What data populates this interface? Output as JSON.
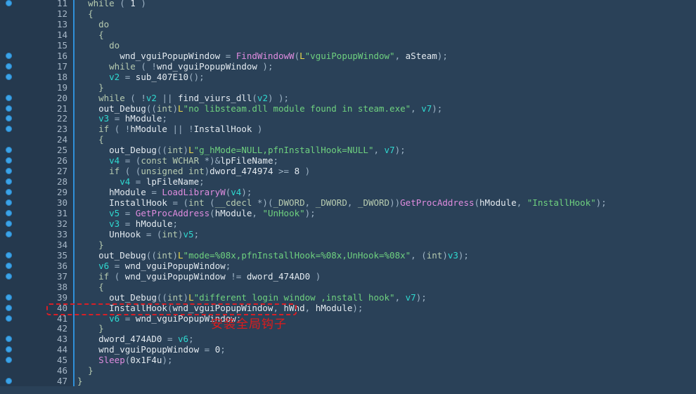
{
  "editor": {
    "kind": "decompiler-pseudocode-view",
    "colors": {
      "background": "#2a4158",
      "gutter": "#25394e",
      "gutter_rule": "#2f8fd8",
      "breakpoint_dot": "#3ba3e8",
      "line_number": "#a8b8c8",
      "keyword": "#b7cbb0",
      "function": "#df8cdf",
      "string": "#6fd17f",
      "wide_string_prefix": "#e8d84a",
      "local_variable": "#2fd9d0",
      "plain": "#e3eaf0",
      "annotation": "#e01b1b"
    },
    "first_line_number": 11,
    "last_line_number": 47
  },
  "annotations": {
    "highlight_box": {
      "target_line": 40,
      "label": "red-dashed-callout-box"
    },
    "note": {
      "text": "安装全局钩子",
      "translation_hint": "install global hook"
    }
  },
  "lines": [
    {
      "n": 11,
      "dot": true,
      "tokens": [
        {
          "c": "t-plain",
          "t": "  "
        },
        {
          "c": "t-kw",
          "t": "while"
        },
        {
          "c": "t-punc",
          "t": " ( "
        },
        {
          "c": "t-num",
          "t": "1"
        },
        {
          "c": "t-punc",
          "t": " )"
        }
      ]
    },
    {
      "n": 12,
      "dot": false,
      "tokens": [
        {
          "c": "t-plain",
          "t": "  "
        },
        {
          "c": "t-brace",
          "t": "{"
        }
      ]
    },
    {
      "n": 13,
      "dot": false,
      "tokens": [
        {
          "c": "t-plain",
          "t": "    "
        },
        {
          "c": "t-kw",
          "t": "do"
        }
      ]
    },
    {
      "n": 14,
      "dot": false,
      "tokens": [
        {
          "c": "t-plain",
          "t": "    "
        },
        {
          "c": "t-brace",
          "t": "{"
        }
      ]
    },
    {
      "n": 15,
      "dot": false,
      "tokens": [
        {
          "c": "t-plain",
          "t": "      "
        },
        {
          "c": "t-kw",
          "t": "do"
        }
      ]
    },
    {
      "n": 16,
      "dot": true,
      "tokens": [
        {
          "c": "t-plain",
          "t": "        wnd_vguiPopupWindow "
        },
        {
          "c": "t-punc",
          "t": "= "
        },
        {
          "c": "t-func",
          "t": "FindWindowW"
        },
        {
          "c": "t-punc",
          "t": "("
        },
        {
          "c": "t-lpfx",
          "t": "L"
        },
        {
          "c": "t-str",
          "t": "\"vguiPopupWindow\""
        },
        {
          "c": "t-punc",
          "t": ", "
        },
        {
          "c": "t-plain",
          "t": "aSteam"
        },
        {
          "c": "t-punc",
          "t": ");"
        }
      ]
    },
    {
      "n": 17,
      "dot": true,
      "tokens": [
        {
          "c": "t-plain",
          "t": "      "
        },
        {
          "c": "t-kw",
          "t": "while"
        },
        {
          "c": "t-punc",
          "t": " ( !"
        },
        {
          "c": "t-plain",
          "t": "wnd_vguiPopupWindow"
        },
        {
          "c": "t-punc",
          "t": " );"
        }
      ]
    },
    {
      "n": 18,
      "dot": true,
      "tokens": [
        {
          "c": "t-plain",
          "t": "      "
        },
        {
          "c": "t-var",
          "t": "v2"
        },
        {
          "c": "t-punc",
          "t": " = "
        },
        {
          "c": "t-plain",
          "t": "sub_407E10"
        },
        {
          "c": "t-punc",
          "t": "();"
        }
      ]
    },
    {
      "n": 19,
      "dot": false,
      "tokens": [
        {
          "c": "t-plain",
          "t": "    "
        },
        {
          "c": "t-brace",
          "t": "}"
        }
      ]
    },
    {
      "n": 20,
      "dot": true,
      "tokens": [
        {
          "c": "t-plain",
          "t": "    "
        },
        {
          "c": "t-kw",
          "t": "while"
        },
        {
          "c": "t-punc",
          "t": " ( !"
        },
        {
          "c": "t-var",
          "t": "v2"
        },
        {
          "c": "t-punc",
          "t": " || "
        },
        {
          "c": "t-plain",
          "t": "find_viurs_dll"
        },
        {
          "c": "t-punc",
          "t": "("
        },
        {
          "c": "t-var",
          "t": "v2"
        },
        {
          "c": "t-punc",
          "t": ") );"
        }
      ]
    },
    {
      "n": 21,
      "dot": true,
      "tokens": [
        {
          "c": "t-plain",
          "t": "    out_Debug"
        },
        {
          "c": "t-punc",
          "t": "(("
        },
        {
          "c": "t-kw",
          "t": "int"
        },
        {
          "c": "t-punc",
          "t": ")"
        },
        {
          "c": "t-lpfx",
          "t": "L"
        },
        {
          "c": "t-str",
          "t": "\"no libsteam.dll module found in steam.exe\""
        },
        {
          "c": "t-punc",
          "t": ", "
        },
        {
          "c": "t-var",
          "t": "v7"
        },
        {
          "c": "t-punc",
          "t": ");"
        }
      ]
    },
    {
      "n": 22,
      "dot": true,
      "tokens": [
        {
          "c": "t-plain",
          "t": "    "
        },
        {
          "c": "t-var",
          "t": "v3"
        },
        {
          "c": "t-punc",
          "t": " = "
        },
        {
          "c": "t-plain",
          "t": "hModule"
        },
        {
          "c": "t-punc",
          "t": ";"
        }
      ]
    },
    {
      "n": 23,
      "dot": true,
      "tokens": [
        {
          "c": "t-plain",
          "t": "    "
        },
        {
          "c": "t-kw",
          "t": "if"
        },
        {
          "c": "t-punc",
          "t": " ( !"
        },
        {
          "c": "t-plain",
          "t": "hModule"
        },
        {
          "c": "t-punc",
          "t": " || !"
        },
        {
          "c": "t-plain",
          "t": "InstallHook"
        },
        {
          "c": "t-punc",
          "t": " )"
        }
      ]
    },
    {
      "n": 24,
      "dot": false,
      "tokens": [
        {
          "c": "t-plain",
          "t": "    "
        },
        {
          "c": "t-brace",
          "t": "{"
        }
      ]
    },
    {
      "n": 25,
      "dot": true,
      "tokens": [
        {
          "c": "t-plain",
          "t": "      out_Debug"
        },
        {
          "c": "t-punc",
          "t": "(("
        },
        {
          "c": "t-kw",
          "t": "int"
        },
        {
          "c": "t-punc",
          "t": ")"
        },
        {
          "c": "t-lpfx",
          "t": "L"
        },
        {
          "c": "t-str",
          "t": "\"g_hMode=NULL,pfnInstallHook=NULL\""
        },
        {
          "c": "t-punc",
          "t": ", "
        },
        {
          "c": "t-var",
          "t": "v7"
        },
        {
          "c": "t-punc",
          "t": ");"
        }
      ]
    },
    {
      "n": 26,
      "dot": true,
      "tokens": [
        {
          "c": "t-plain",
          "t": "      "
        },
        {
          "c": "t-var",
          "t": "v4"
        },
        {
          "c": "t-punc",
          "t": " = ("
        },
        {
          "c": "t-kw",
          "t": "const WCHAR "
        },
        {
          "c": "t-punc",
          "t": "*)&"
        },
        {
          "c": "t-plain",
          "t": "lpFileName"
        },
        {
          "c": "t-punc",
          "t": ";"
        }
      ]
    },
    {
      "n": 27,
      "dot": true,
      "tokens": [
        {
          "c": "t-plain",
          "t": "      "
        },
        {
          "c": "t-kw",
          "t": "if"
        },
        {
          "c": "t-punc",
          "t": " ( ("
        },
        {
          "c": "t-kw",
          "t": "unsigned int"
        },
        {
          "c": "t-punc",
          "t": ")"
        },
        {
          "c": "t-plain",
          "t": "dword_474974"
        },
        {
          "c": "t-punc",
          "t": " >= "
        },
        {
          "c": "t-num",
          "t": "8"
        },
        {
          "c": "t-punc",
          "t": " )"
        }
      ]
    },
    {
      "n": 28,
      "dot": true,
      "tokens": [
        {
          "c": "t-plain",
          "t": "        "
        },
        {
          "c": "t-var",
          "t": "v4"
        },
        {
          "c": "t-punc",
          "t": " = "
        },
        {
          "c": "t-plain",
          "t": "lpFileName"
        },
        {
          "c": "t-punc",
          "t": ";"
        }
      ]
    },
    {
      "n": 29,
      "dot": true,
      "tokens": [
        {
          "c": "t-plain",
          "t": "      hModule "
        },
        {
          "c": "t-punc",
          "t": "= "
        },
        {
          "c": "t-func",
          "t": "LoadLibraryW"
        },
        {
          "c": "t-punc",
          "t": "("
        },
        {
          "c": "t-var",
          "t": "v4"
        },
        {
          "c": "t-punc",
          "t": ");"
        }
      ]
    },
    {
      "n": 30,
      "dot": true,
      "tokens": [
        {
          "c": "t-plain",
          "t": "      InstallHook "
        },
        {
          "c": "t-punc",
          "t": "= ("
        },
        {
          "c": "t-kw",
          "t": "int"
        },
        {
          "c": "t-punc",
          "t": " ("
        },
        {
          "c": "t-kw",
          "t": "__cdecl"
        },
        {
          "c": "t-punc",
          "t": " *)("
        },
        {
          "c": "t-kw",
          "t": "_DWORD"
        },
        {
          "c": "t-punc",
          "t": ", "
        },
        {
          "c": "t-kw",
          "t": "_DWORD"
        },
        {
          "c": "t-punc",
          "t": ", "
        },
        {
          "c": "t-kw",
          "t": "_DWORD"
        },
        {
          "c": "t-punc",
          "t": "))"
        },
        {
          "c": "t-func",
          "t": "GetProcAddress"
        },
        {
          "c": "t-punc",
          "t": "("
        },
        {
          "c": "t-plain",
          "t": "hModule"
        },
        {
          "c": "t-punc",
          "t": ", "
        },
        {
          "c": "t-str",
          "t": "\"InstallHook\""
        },
        {
          "c": "t-punc",
          "t": ");"
        }
      ]
    },
    {
      "n": 31,
      "dot": true,
      "tokens": [
        {
          "c": "t-plain",
          "t": "      "
        },
        {
          "c": "t-var",
          "t": "v5"
        },
        {
          "c": "t-punc",
          "t": " = "
        },
        {
          "c": "t-func",
          "t": "GetProcAddress"
        },
        {
          "c": "t-punc",
          "t": "("
        },
        {
          "c": "t-plain",
          "t": "hModule"
        },
        {
          "c": "t-punc",
          "t": ", "
        },
        {
          "c": "t-str",
          "t": "\"UnHook\""
        },
        {
          "c": "t-punc",
          "t": ");"
        }
      ]
    },
    {
      "n": 32,
      "dot": true,
      "tokens": [
        {
          "c": "t-plain",
          "t": "      "
        },
        {
          "c": "t-var",
          "t": "v3"
        },
        {
          "c": "t-punc",
          "t": " = "
        },
        {
          "c": "t-plain",
          "t": "hModule"
        },
        {
          "c": "t-punc",
          "t": ";"
        }
      ]
    },
    {
      "n": 33,
      "dot": true,
      "tokens": [
        {
          "c": "t-plain",
          "t": "      UnHook "
        },
        {
          "c": "t-punc",
          "t": "= ("
        },
        {
          "c": "t-kw",
          "t": "int"
        },
        {
          "c": "t-punc",
          "t": ")"
        },
        {
          "c": "t-var",
          "t": "v5"
        },
        {
          "c": "t-punc",
          "t": ";"
        }
      ]
    },
    {
      "n": 34,
      "dot": false,
      "tokens": [
        {
          "c": "t-plain",
          "t": "    "
        },
        {
          "c": "t-brace",
          "t": "}"
        }
      ]
    },
    {
      "n": 35,
      "dot": true,
      "tokens": [
        {
          "c": "t-plain",
          "t": "    out_Debug"
        },
        {
          "c": "t-punc",
          "t": "(("
        },
        {
          "c": "t-kw",
          "t": "int"
        },
        {
          "c": "t-punc",
          "t": ")"
        },
        {
          "c": "t-lpfx",
          "t": "L"
        },
        {
          "c": "t-str",
          "t": "\"mode=%08x,pfnInstallHook=%08x,UnHook=%08x\""
        },
        {
          "c": "t-punc",
          "t": ", ("
        },
        {
          "c": "t-kw",
          "t": "int"
        },
        {
          "c": "t-punc",
          "t": ")"
        },
        {
          "c": "t-var",
          "t": "v3"
        },
        {
          "c": "t-punc",
          "t": ");"
        }
      ]
    },
    {
      "n": 36,
      "dot": true,
      "tokens": [
        {
          "c": "t-plain",
          "t": "    "
        },
        {
          "c": "t-var",
          "t": "v6"
        },
        {
          "c": "t-punc",
          "t": " = "
        },
        {
          "c": "t-plain",
          "t": "wnd_vguiPopupWindow"
        },
        {
          "c": "t-punc",
          "t": ";"
        }
      ]
    },
    {
      "n": 37,
      "dot": true,
      "tokens": [
        {
          "c": "t-plain",
          "t": "    "
        },
        {
          "c": "t-kw",
          "t": "if"
        },
        {
          "c": "t-punc",
          "t": " ( "
        },
        {
          "c": "t-plain",
          "t": "wnd_vguiPopupWindow"
        },
        {
          "c": "t-punc",
          "t": " != "
        },
        {
          "c": "t-plain",
          "t": "dword_474AD0"
        },
        {
          "c": "t-punc",
          "t": " )"
        }
      ]
    },
    {
      "n": 38,
      "dot": false,
      "tokens": [
        {
          "c": "t-plain",
          "t": "    "
        },
        {
          "c": "t-brace",
          "t": "{"
        }
      ]
    },
    {
      "n": 39,
      "dot": true,
      "tokens": [
        {
          "c": "t-plain",
          "t": "      out_Debug"
        },
        {
          "c": "t-punc",
          "t": "(("
        },
        {
          "c": "t-kw",
          "t": "int"
        },
        {
          "c": "t-punc",
          "t": ")"
        },
        {
          "c": "t-lpfx",
          "t": "L"
        },
        {
          "c": "t-str",
          "t": "\"different login window ,install hook\""
        },
        {
          "c": "t-punc",
          "t": ", "
        },
        {
          "c": "t-var",
          "t": "v7"
        },
        {
          "c": "t-punc",
          "t": ");"
        }
      ]
    },
    {
      "n": 40,
      "dot": true,
      "tokens": [
        {
          "c": "t-plain",
          "t": "      InstallHook"
        },
        {
          "c": "t-punc",
          "t": "("
        },
        {
          "c": "t-plain",
          "t": "wnd_vguiPopupWindow"
        },
        {
          "c": "t-punc",
          "t": ", "
        },
        {
          "c": "t-plain",
          "t": "hWnd"
        },
        {
          "c": "t-punc",
          "t": ", "
        },
        {
          "c": "t-plain",
          "t": "hModule"
        },
        {
          "c": "t-punc",
          "t": ");"
        }
      ]
    },
    {
      "n": 41,
      "dot": true,
      "tokens": [
        {
          "c": "t-plain",
          "t": "      "
        },
        {
          "c": "t-var",
          "t": "v6"
        },
        {
          "c": "t-punc",
          "t": " = "
        },
        {
          "c": "t-plain",
          "t": "wnd_vguiPopupWindow"
        },
        {
          "c": "t-punc",
          "t": ";"
        }
      ]
    },
    {
      "n": 42,
      "dot": false,
      "tokens": [
        {
          "c": "t-plain",
          "t": "    "
        },
        {
          "c": "t-brace",
          "t": "}"
        }
      ]
    },
    {
      "n": 43,
      "dot": true,
      "tokens": [
        {
          "c": "t-plain",
          "t": "    dword_474AD0 "
        },
        {
          "c": "t-punc",
          "t": "= "
        },
        {
          "c": "t-var",
          "t": "v6"
        },
        {
          "c": "t-punc",
          "t": ";"
        }
      ]
    },
    {
      "n": 44,
      "dot": true,
      "tokens": [
        {
          "c": "t-plain",
          "t": "    wnd_vguiPopupWindow "
        },
        {
          "c": "t-punc",
          "t": "= "
        },
        {
          "c": "t-num",
          "t": "0"
        },
        {
          "c": "t-punc",
          "t": ";"
        }
      ]
    },
    {
      "n": 45,
      "dot": true,
      "tokens": [
        {
          "c": "t-plain",
          "t": "    "
        },
        {
          "c": "t-func",
          "t": "Sleep"
        },
        {
          "c": "t-punc",
          "t": "("
        },
        {
          "c": "t-num",
          "t": "0x1F4u"
        },
        {
          "c": "t-punc",
          "t": ");"
        }
      ]
    },
    {
      "n": 46,
      "dot": false,
      "tokens": [
        {
          "c": "t-plain",
          "t": "  "
        },
        {
          "c": "t-brace",
          "t": "}"
        }
      ]
    },
    {
      "n": 47,
      "dot": true,
      "tokens": [
        {
          "c": "t-brace",
          "t": "}"
        }
      ]
    }
  ]
}
